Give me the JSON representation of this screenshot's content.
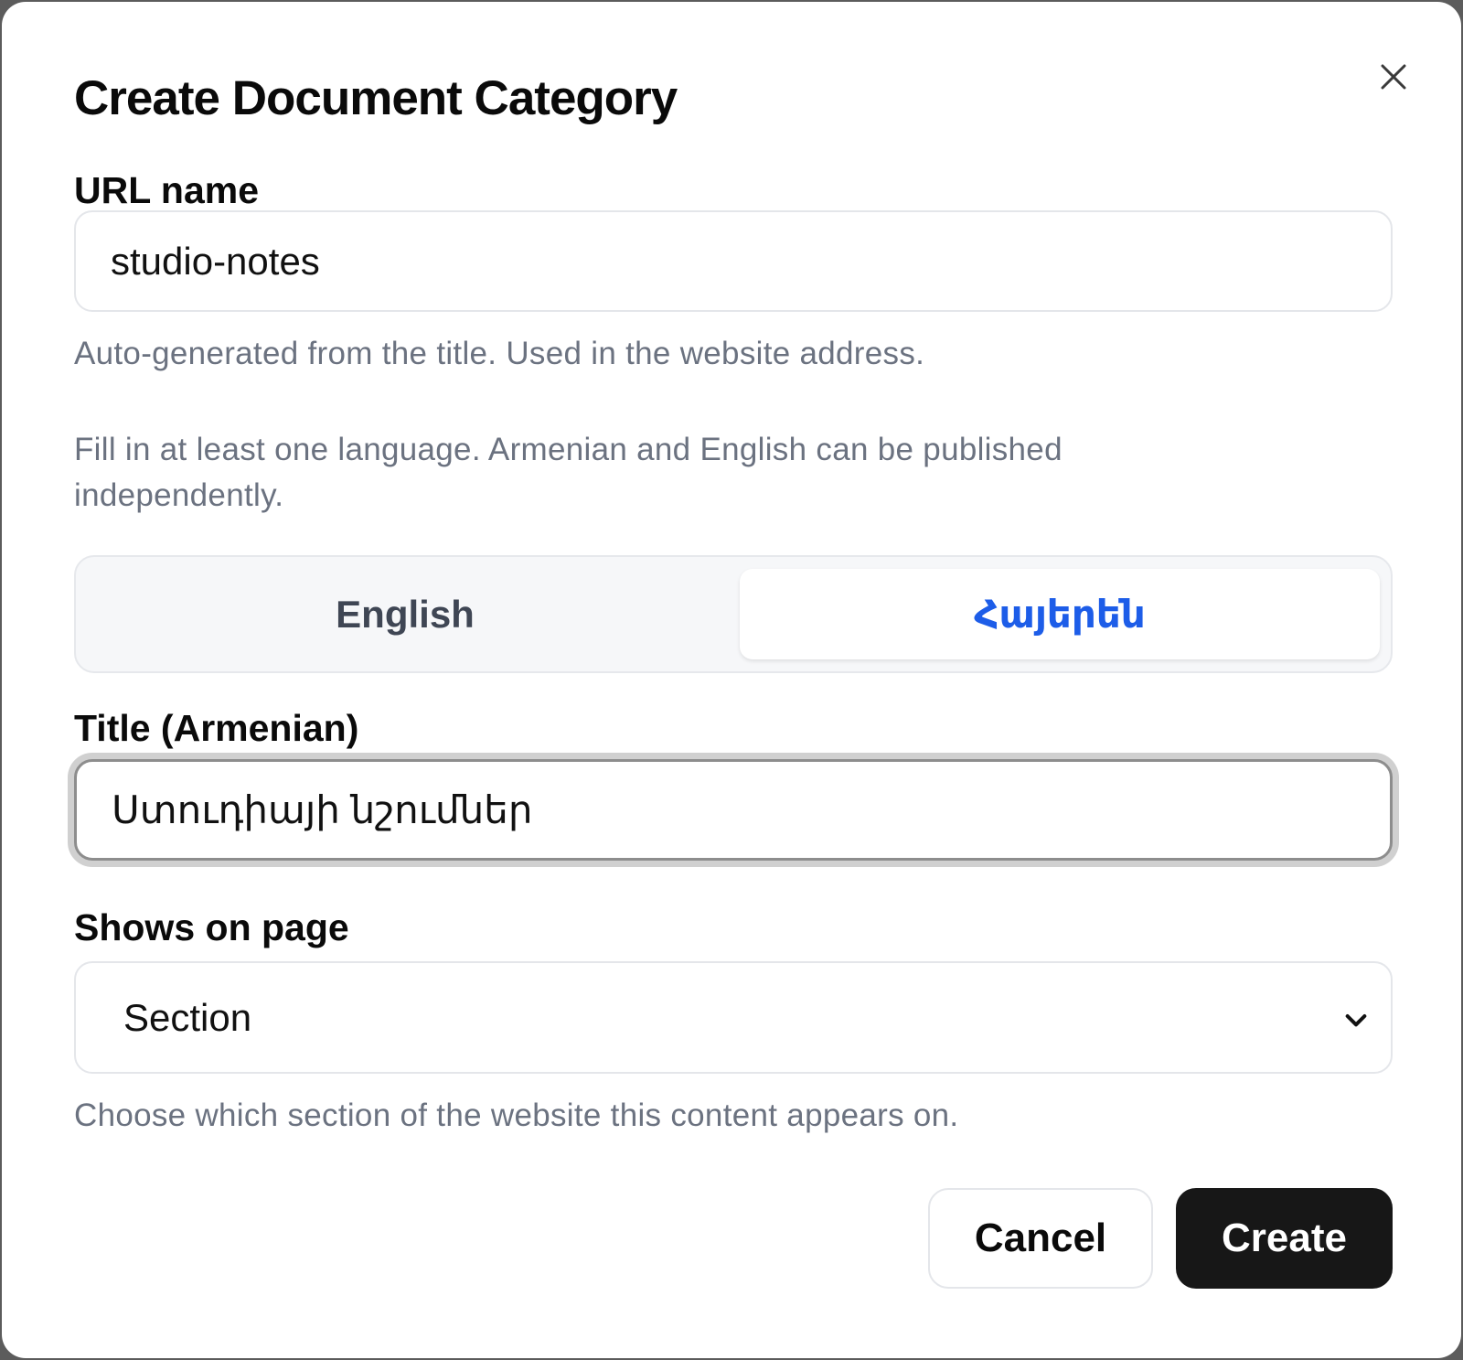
{
  "dialog": {
    "title": "Create Document Category",
    "close_icon": "close-icon"
  },
  "url_name": {
    "label": "URL name",
    "value": "studio-notes",
    "hint": "Auto-generated from the title. Used in the website address."
  },
  "language_note": {
    "line1": "Fill in at least one language. Armenian and English can be published",
    "line2": "independently."
  },
  "language_tabs": {
    "items": [
      {
        "label": "English",
        "active": false
      },
      {
        "label": "Հայերեն",
        "active": true
      }
    ]
  },
  "title_field": {
    "label": "Title (Armenian)",
    "value": "Ստուդիայի նշումներ"
  },
  "page_select": {
    "label": "Shows on page",
    "selected": "Section",
    "hint": "Choose which section of the website this content appears on."
  },
  "actions": {
    "cancel_label": "Cancel",
    "create_label": "Create"
  },
  "colors": {
    "accent": "#1d5de8",
    "primary_button": "#171717",
    "hint_text": "#6b7280"
  }
}
